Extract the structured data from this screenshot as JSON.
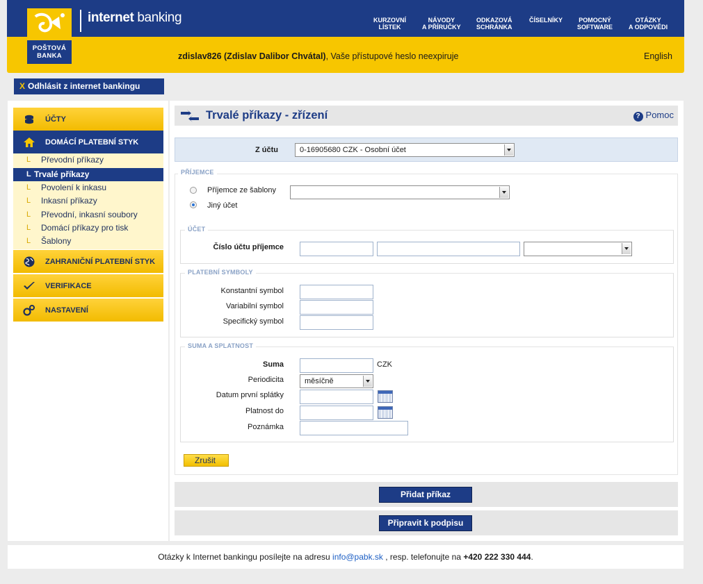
{
  "header": {
    "brand_bold": "internet",
    "brand_rest": " banking",
    "logo_line1": "POŠTOVÁ",
    "logo_line2": "BANKA",
    "nav": [
      {
        "label": "KURZOVNÍ\nLÍSTEK"
      },
      {
        "label": "NÁVODY\nA PŘÍRUČKY"
      },
      {
        "label": "ODKAZOVÁ\nSCHRÁNKA"
      },
      {
        "label": "ČÍSELNÍKY"
      },
      {
        "label": "POMOCNÝ\nSOFTWARE"
      },
      {
        "label": "OTÁZKY\nA ODPOVĚDI"
      }
    ],
    "user_bold": "zdislav826 (Zdislav Dalibor Chvátal)",
    "user_rest": ", Vaše přístupové heslo neexpiruje",
    "language": "English"
  },
  "logout": {
    "x": "X",
    "label": "Odhlásit z internet bankingu"
  },
  "sidebar": {
    "sections": [
      {
        "label": "ÚČTY",
        "icon": "coins-icon"
      },
      {
        "label": "DOMÁCÍ PLATEBNÍ STYK",
        "icon": "home-icon"
      },
      {
        "label": "ZAHRANIČNÍ PLATEBNÍ STYK",
        "icon": "globe-icon"
      },
      {
        "label": "VERIFIKACE",
        "icon": "checkmark-icon"
      },
      {
        "label": "NASTAVENÍ",
        "icon": "gears-icon"
      }
    ],
    "items": [
      {
        "label": "Převodní příkazy"
      },
      {
        "label": "Trvalé příkazy"
      },
      {
        "label": "Povolení k inkasu"
      },
      {
        "label": "Inkasní příkazy"
      },
      {
        "label": "Převodní, inkasní soubory"
      },
      {
        "label": "Domácí příkazy pro tisk"
      },
      {
        "label": "Šablony"
      }
    ],
    "item_marker": "L"
  },
  "main": {
    "title": "Trvalé příkazy - zřízení",
    "help": "Pomoc",
    "from_account_label": "Z účtu",
    "from_account_value": "0-16905680 CZK - Osobní účet",
    "recipient": {
      "legend": "PŘÍJEMCE",
      "option_template": "Příjemce ze šablony",
      "option_other": "Jiný účet",
      "template_value": ""
    },
    "account": {
      "legend": "ÚČET",
      "label": "Číslo účtu příjemce"
    },
    "symbols": {
      "legend": "PLATEBNÍ SYMBOLY",
      "constant": "Konstantní symbol",
      "variable": "Variabilní symbol",
      "specific": "Specifický symbol"
    },
    "amount": {
      "legend": "SUMA A SPLATNOST",
      "sum": "Suma",
      "currency": "CZK",
      "periodicity": "Periodicita",
      "periodicity_value": "měsíčně",
      "first_date": "Datum první splátky",
      "valid_until": "Platnost do",
      "note": "Poznámka"
    },
    "cancel": "Zrušit",
    "add": "Přidat příkaz",
    "sign": "Připravit k podpisu"
  },
  "footer": {
    "text1": "Otázky k Internet bankingu posílejte na adresu ",
    "email": "info@pabk.sk",
    "text2": " , resp. telefonujte na ",
    "phone": "+420 222 330 444",
    "text3": "."
  },
  "colors": {
    "brand_blue": "#1d3c86",
    "brand_yellow": "#f7c600"
  }
}
